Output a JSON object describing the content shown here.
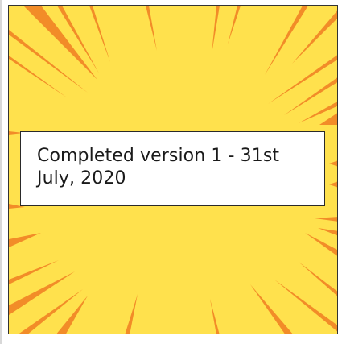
{
  "panel": {
    "background_color": "#FFE14D",
    "burst_color": "#F28C28",
    "caption": "Completed version 1 - 31st July, 2020"
  }
}
